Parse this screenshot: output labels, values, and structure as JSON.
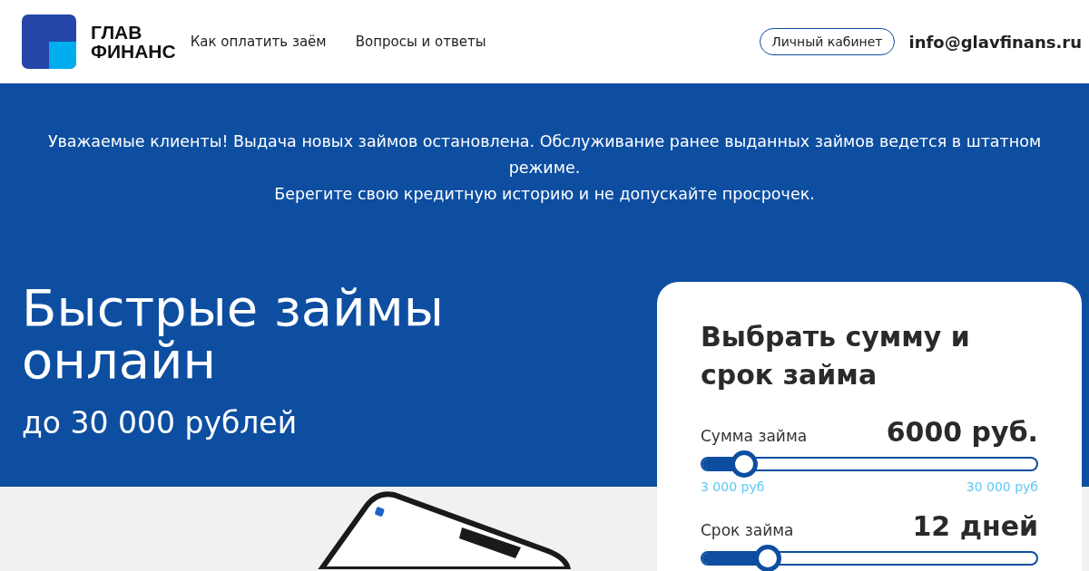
{
  "header": {
    "logo_text": [
      "ГЛАВ",
      "ФИНАНС"
    ],
    "nav": [
      {
        "label": "Как оплатить заём"
      },
      {
        "label": "Вопросы и ответы"
      }
    ],
    "account_button": "Личный кабинет",
    "email": "info@glavfinans.ru"
  },
  "notice": [
    "Уважаемые клиенты! Выдача новых займов остановлена. Обслуживание ранее выданных займов ведется в штатном режиме.",
    "Берегите свою кредитную историю и не допускайте просрочек."
  ],
  "hero": {
    "title": "Быстрые займы онлайн",
    "subtitle": "до 30 000 рублей"
  },
  "calculator": {
    "title": "Выбрать сумму и срок займа",
    "sliders": [
      {
        "label": "Сумма займа",
        "reading": "6000 руб.",
        "level": 0.13,
        "min": "3 000 руб",
        "max": "30 000 руб"
      },
      {
        "label": "Срок займа",
        "reading": "12 дней",
        "level": 0.2
      }
    ]
  }
}
